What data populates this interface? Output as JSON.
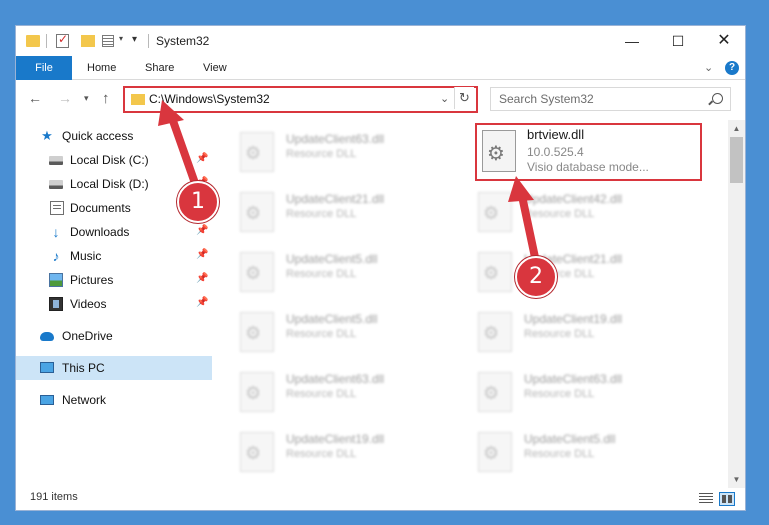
{
  "window": {
    "title": "System32",
    "minimize_glyph": "—",
    "maximize_glyph": "☐",
    "close_glyph": "✕"
  },
  "quick_access_toolbar": {
    "dropdown_glyph": "▾",
    "pin_glyph": "▾"
  },
  "ribbon": {
    "tabs": [
      "File",
      "Home",
      "Share",
      "View"
    ],
    "expand_glyph": "⌄",
    "help_glyph": "?"
  },
  "navigation": {
    "back_glyph": "←",
    "forward_glyph": "→",
    "recent_glyph": "▾",
    "up_glyph": "↑",
    "address": "C:\\Windows\\System32",
    "address_dropdown_glyph": "⌄",
    "refresh_glyph": "↻",
    "search_placeholder": "Search System32"
  },
  "sidebar": {
    "items": [
      {
        "label": "Quick access",
        "icon": "star-icon"
      },
      {
        "label": "Local Disk (C:)",
        "icon": "drive-icon",
        "pinned": true
      },
      {
        "label": "Local Disk (D:)",
        "icon": "drive-icon",
        "pinned": true
      },
      {
        "label": "Documents",
        "icon": "documents-icon",
        "pinned": true
      },
      {
        "label": "Downloads",
        "icon": "downloads-icon",
        "pinned": true
      },
      {
        "label": "Music",
        "icon": "music-icon",
        "pinned": true
      },
      {
        "label": "Pictures",
        "icon": "pictures-icon",
        "pinned": true
      },
      {
        "label": "Videos",
        "icon": "videos-icon",
        "pinned": true
      },
      {
        "label": "OneDrive",
        "icon": "onedrive-icon"
      },
      {
        "label": "This PC",
        "icon": "pc-icon",
        "selected": true
      },
      {
        "label": "Network",
        "icon": "network-icon"
      }
    ],
    "pin_glyph": "📌"
  },
  "files": {
    "left_column": [
      {
        "name": "UpdateClient63.dll",
        "type": "Resource DLL"
      },
      {
        "name": "UpdateClient21.dll",
        "type": "Resource DLL"
      },
      {
        "name": "UpdateClient5.dll",
        "type": "Resource DLL"
      },
      {
        "name": "UpdateClient5.dll",
        "type": "Resource DLL"
      },
      {
        "name": "UpdateClient63.dll",
        "type": "Resource DLL"
      },
      {
        "name": "UpdateClient19.dll",
        "type": "Resource DLL"
      }
    ],
    "right_column": [
      {
        "name": "UpdateClient42.dll",
        "type": "Resource DLL"
      },
      {
        "name": "UpdateClient21.dll",
        "type": "Resource DLL"
      },
      {
        "name": "UpdateClient19.dll",
        "type": "Resource DLL"
      },
      {
        "name": "UpdateClient63.dll",
        "type": "Resource DLL"
      },
      {
        "name": "UpdateClient5.dll",
        "type": "Resource DLL"
      }
    ],
    "selected": {
      "name": "brtview.dll",
      "version": "10.0.525.4",
      "description": "Visio database mode..."
    }
  },
  "scrollbar": {
    "up_glyph": "▲",
    "down_glyph": "▼"
  },
  "status": {
    "item_count": "191 items"
  },
  "annotations": [
    {
      "number": "1",
      "color": "#d9363e"
    },
    {
      "number": "2",
      "color": "#d9363e"
    }
  ]
}
